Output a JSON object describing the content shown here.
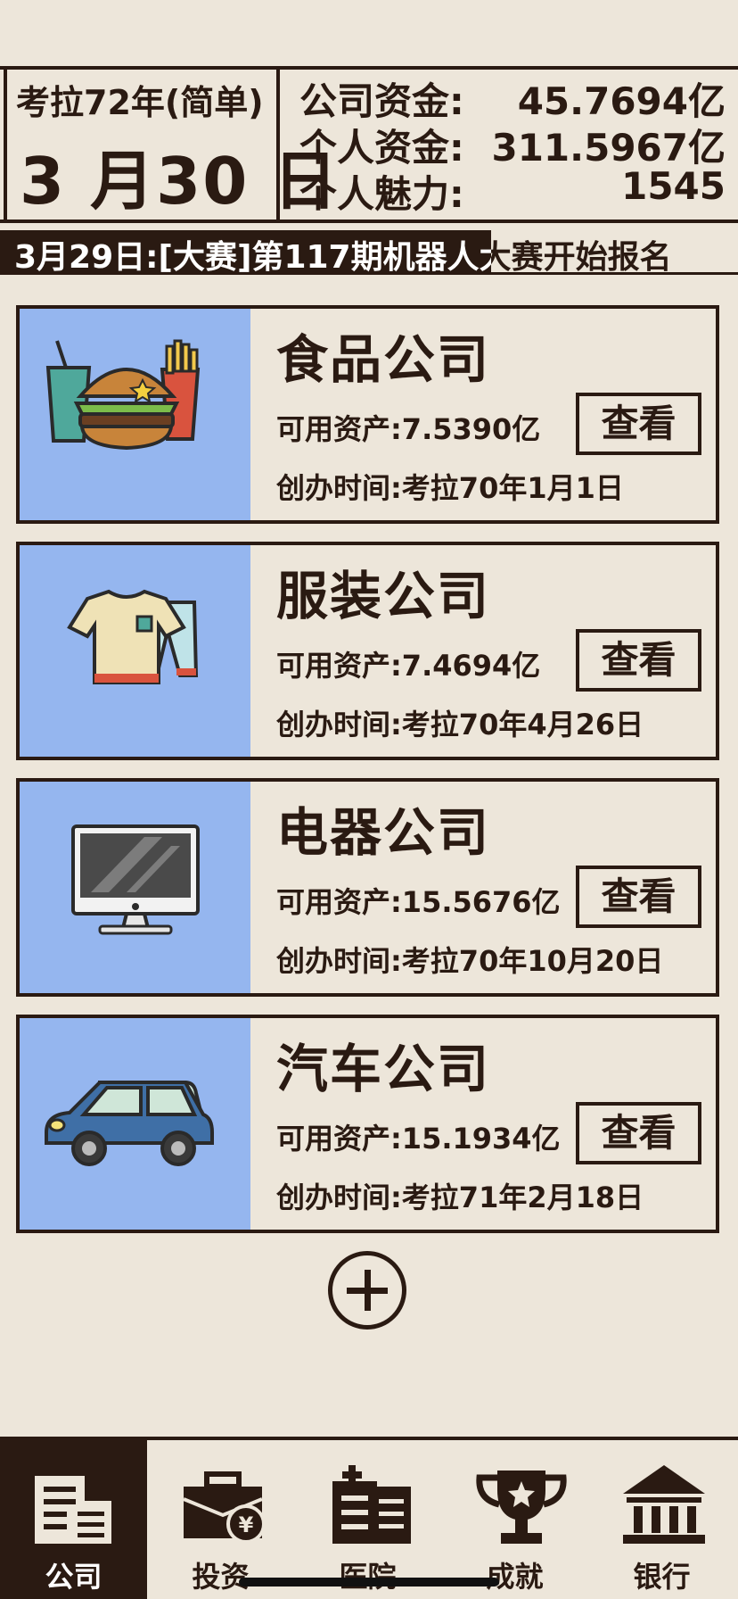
{
  "header": {
    "year_mode": "考拉72年(简单)",
    "date": "3 月30 日",
    "stats": [
      {
        "label": "公司资金:",
        "value": "45.7694亿"
      },
      {
        "label": "个人资金:",
        "value": "311.5967亿"
      },
      {
        "label": "个人魅力:",
        "value": "1545"
      }
    ]
  },
  "news": {
    "text": "3月29日:[大赛]第117期机器人大赛开始报名"
  },
  "companies": [
    {
      "name": "食品公司",
      "assets": "可用资产:7.5390亿",
      "founded": "创办时间:考拉70年1月1日",
      "view_label": "查看",
      "icon": "food-icon"
    },
    {
      "name": "服装公司",
      "assets": "可用资产:7.4694亿",
      "founded": "创办时间:考拉70年4月26日",
      "view_label": "查看",
      "icon": "clothes-icon"
    },
    {
      "name": "电器公司",
      "assets": "可用资产:15.5676亿",
      "founded": "创办时间:考拉70年10月20日",
      "view_label": "查看",
      "icon": "monitor-icon"
    },
    {
      "name": "汽车公司",
      "assets": "可用资产:15.1934亿",
      "founded": "创办时间:考拉71年2月18日",
      "view_label": "查看",
      "icon": "car-icon"
    }
  ],
  "nav": {
    "items": [
      {
        "label": "公司",
        "icon": "building-icon",
        "active": true
      },
      {
        "label": "投资",
        "icon": "briefcase-icon",
        "active": false
      },
      {
        "label": "医院",
        "icon": "hospital-icon",
        "active": false
      },
      {
        "label": "成就",
        "icon": "trophy-icon",
        "active": false
      },
      {
        "label": "银行",
        "icon": "bank-icon",
        "active": false
      }
    ]
  },
  "colors": {
    "background": "#ede6da",
    "dark": "#2a1a12",
    "card_image_bg": "#95b6ef"
  }
}
